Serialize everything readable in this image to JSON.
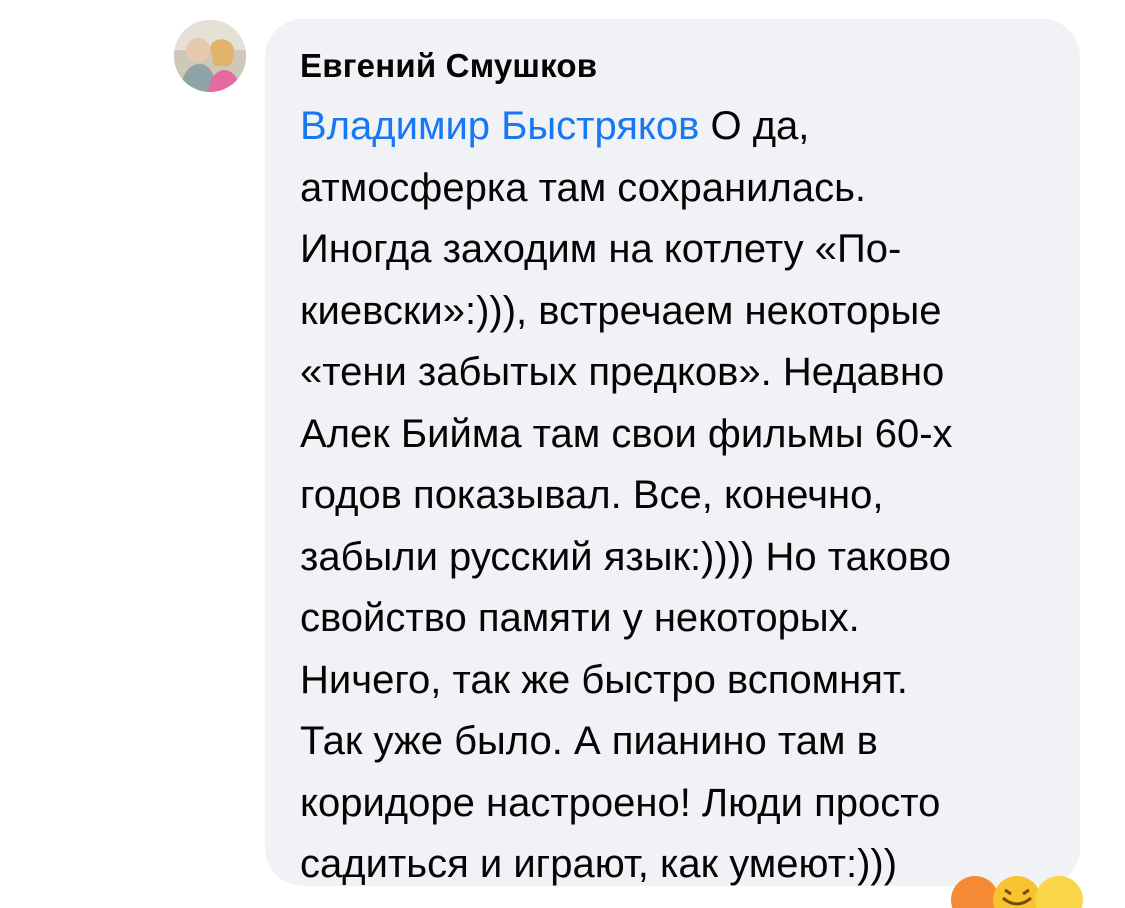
{
  "comment": {
    "author": "Евгений Смушков",
    "mention": "Владимир Быстряков",
    "lines": [
      " О да,",
      "атмосферка там сохранилась.",
      "Иногда заходим на котлету «По-",
      "киевски»:))), встречаем некоторые",
      "«тени забытых предков». Недавно",
      "Алек Бийма там свои фильмы 60-х",
      "годов показывал. Все, конечно,",
      "забыли русский язык:)))) Но таково",
      "свойство памяти у некоторых.",
      "Ничего, так же быстро вспомнят.",
      "Так уже было. А пианино там в",
      "коридоре настроено! Люди просто",
      "садиться и играют, как умеют:)))"
    ]
  },
  "reactions": {
    "icons": [
      "haha-reaction-icon",
      "laugh-reaction-icon",
      "like-reaction-icon"
    ]
  },
  "colors": {
    "bubble": "#f0f2f5",
    "mention": "#1877f2",
    "text": "#050505"
  }
}
